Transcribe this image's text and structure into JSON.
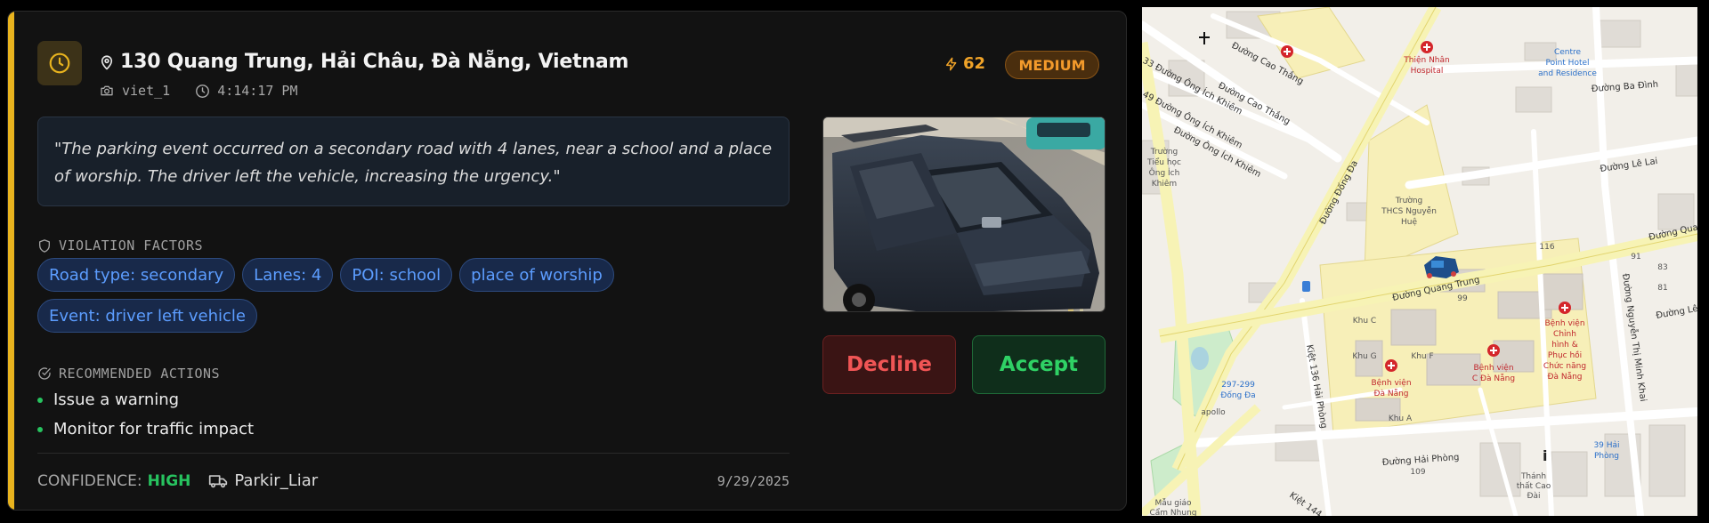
{
  "event": {
    "address": "130 Quang Trung, Hải Châu, Đà Nẵng, Vietnam",
    "camera": "viet_1",
    "time": "4:14:17 PM",
    "score": "62",
    "severity": "MEDIUM",
    "quote": "\"The parking event occurred on a secondary road with 4 lanes, near a school and a place of worship. The driver left the vehicle, increasing the urgency.\"",
    "factors_title": "VIOLATION FACTORS",
    "factors": [
      "Road type: secondary",
      "Lanes: 4",
      "POI: school",
      "place of worship",
      "Event: driver left vehicle"
    ],
    "actions_title": "RECOMMENDED ACTIONS",
    "actions": [
      "Issue a warning",
      "Monitor for traffic impact"
    ],
    "confidence_label": "CONFIDENCE:",
    "confidence_value": "HIGH",
    "vehicle_type": "Parkir_Liar",
    "date": "9/29/2025",
    "decline_label": "Decline",
    "accept_label": "Accept"
  },
  "colors": {
    "accent": "#e8b31e",
    "severity": "#f39a2b",
    "chip_text": "#5c9dff",
    "confidence": "#27c35f",
    "decline": "#f05555",
    "accept": "#2fd165"
  },
  "map": {
    "labels": {
      "cao_thang_1": "Đường Cao Thắng",
      "cao_thang_2": "Đường Cao Thắng",
      "ong_ich_khiem_1": "33 Đường Ông Ích Khiêm",
      "ong_ich_khiem_2": "49 Đường Ông Ích Khiêm",
      "ong_ich_khiem_3": "Đường Ông Ích Khiêm",
      "dong_da": "Đường Đống Đa",
      "thien_nhan_1": "Thiện Nhân",
      "thien_nhan_2": "Hospital",
      "centre_1": "Centre",
      "centre_2": "Point Hotel",
      "centre_3": "and Residence",
      "ba_dinh": "Đường Ba Đình",
      "le_lai": "Đường Lê Lai",
      "quang_trung_1": "Đường Quang Trung",
      "quang_trung_2": "Đường Qua",
      "school_1": "Trường",
      "school_2": "THCS Nguyễn",
      "school_3": "Huệ",
      "truong_1": "Trường",
      "truong_2": "Tiểu học",
      "truong_3": "Ông Ích",
      "truong_4": "Khiêm",
      "nguyen_thi_minh_khai": "Đường Nguyễn Thị Minh Khai",
      "kiet_136": "Kiệt 136 Hải Phòng",
      "hai_phong": "Đường Hải Phòng",
      "khu_c": "Khu C",
      "khu_g": "Khu G",
      "khu_f": "Khu F",
      "khu_a": "Khu A",
      "bv_dn_1": "Bệnh viện",
      "bv_dn_2": "Đà Nẵng",
      "bv_c_1": "Bệnh viện",
      "bv_c_2": "C Đà Nẵng",
      "bv_ch_1": "Bệnh viện",
      "bv_ch_2": "Chỉnh",
      "bv_ch_3": "hình &",
      "bv_ch_4": "Phục hồi",
      "bv_ch_5": "Chức năng",
      "bv_ch_6": "Đà Nẵng",
      "dong_da_297_1": "297-299",
      "dong_da_297_2": "Đống Đa",
      "apollo": "apollo",
      "hai_phong_39_1": "39 Hải",
      "hai_phong_39_2": "Phòng",
      "thanh_that_1": "Thánh",
      "thanh_that_2": "thất Cao",
      "thanh_that_3": "Đài",
      "mau_giao_1": "Mẫu giáo",
      "mau_giao_2": "Cẩm Nhung",
      "kiet_144": "Kiệt 144",
      "n99": "99",
      "n91": "91",
      "n83": "83",
      "n81": "81",
      "n116": "116",
      "n109": "109",
      "lele": "Đường Lê"
    }
  }
}
